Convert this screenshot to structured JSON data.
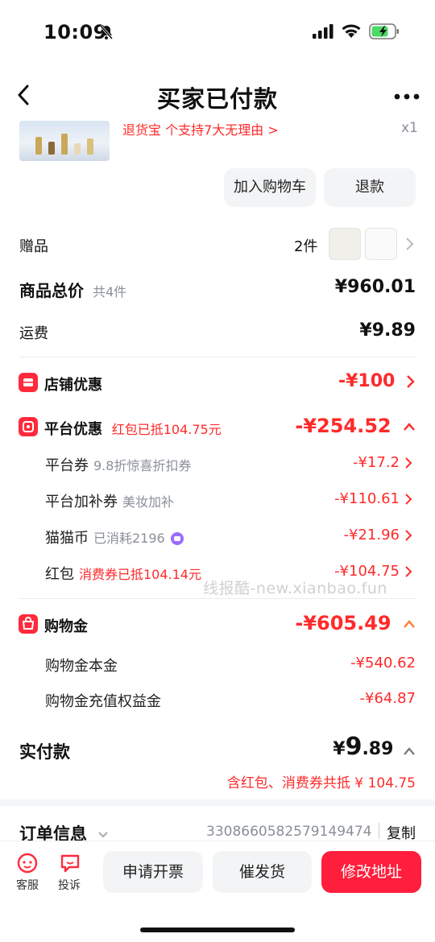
{
  "status": {
    "time": "10:09"
  },
  "nav": {
    "title": "买家已付款"
  },
  "product": {
    "tag_line": "退货宝  个支持7大无理由 >",
    "qty": "x1"
  },
  "actions": {
    "add_cart": "加入购物车",
    "refund": "退款"
  },
  "gift": {
    "label": "赠品",
    "count": "2件"
  },
  "summary": {
    "total_label": "商品总价",
    "total_count": "共4件",
    "total_value": "¥960.01",
    "shipping_label": "运费",
    "shipping_value": "¥9.89"
  },
  "store_discount": {
    "label": "店铺优惠",
    "value": "-¥100"
  },
  "platform_discount": {
    "label": "平台优惠",
    "tag": "红包已抵104.75元",
    "value": "-¥254.52",
    "items": [
      {
        "label": "平台券",
        "tag": "9.8折惊喜折扣券",
        "value": "-¥17.2"
      },
      {
        "label": "平台加补券",
        "tag": "美妆加补",
        "value": "-¥110.61"
      },
      {
        "label": "猫猫币",
        "tag": "已消耗2196",
        "value": "-¥21.96"
      },
      {
        "label": "红包",
        "tag": "消费券已抵104.14元",
        "value": "-¥104.75"
      }
    ]
  },
  "shopping_gold": {
    "label": "购物金",
    "value": "-¥605.49",
    "items": [
      {
        "label": "购物金本金",
        "value": "-¥540.62"
      },
      {
        "label": "购物金充值权益金",
        "value": "-¥64.87"
      }
    ]
  },
  "paid": {
    "label": "实付款",
    "currency": "¥",
    "integer": "9",
    "decimal": ".89",
    "note": "含红包、消费券共抵 ¥ 104.75"
  },
  "order_info": {
    "label": "订单信息",
    "order_no": "3308660582579149474",
    "copy": "复制"
  },
  "bottom": {
    "service": "客服",
    "complain": "投诉",
    "invoice": "申请开票",
    "urge": "催发货",
    "modify_address": "修改地址"
  },
  "watermark": "线报酷-new.xianbao.fun",
  "colors": {
    "accent": "#ff2a2a",
    "primary_button": "#ff1e3c"
  }
}
